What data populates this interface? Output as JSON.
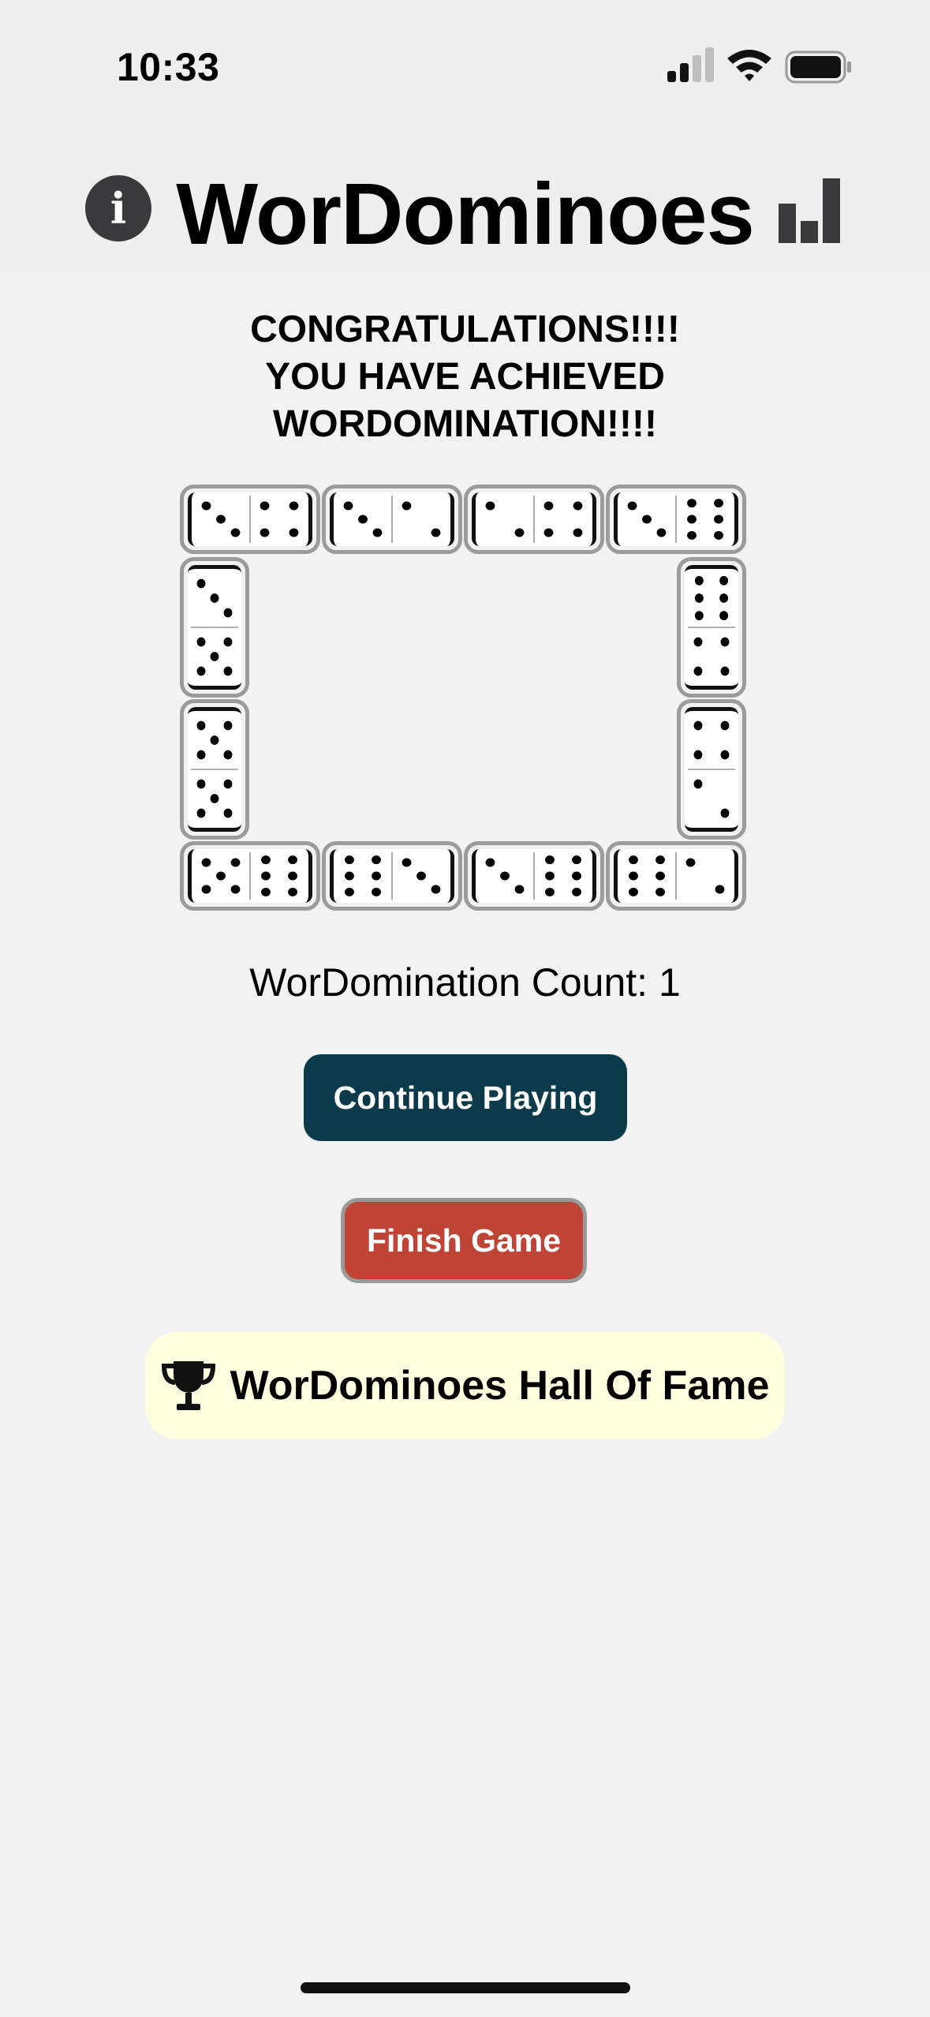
{
  "status_bar": {
    "time": "10:33"
  },
  "header": {
    "title": "WorDominoes",
    "info_icon": "info-icon",
    "stats_icon": "bar-chart-icon"
  },
  "congrats": {
    "line1": "CONGRATULATIONS!!!!",
    "line2": "YOU HAVE ACHIEVED",
    "line3": "WORDOMINATION!!!!"
  },
  "dominoes": [
    {
      "orientation": "horizontal",
      "pips": [
        3,
        4
      ]
    },
    {
      "orientation": "horizontal",
      "pips": [
        3,
        2
      ]
    },
    {
      "orientation": "horizontal",
      "pips": [
        2,
        4
      ]
    },
    {
      "orientation": "horizontal",
      "pips": [
        3,
        6
      ]
    },
    {
      "orientation": "vertical",
      "pips": [
        3,
        5
      ]
    },
    {
      "orientation": "vertical",
      "pips": [
        6,
        4
      ]
    },
    {
      "orientation": "vertical",
      "pips": [
        5,
        5
      ]
    },
    {
      "orientation": "vertical",
      "pips": [
        4,
        2
      ]
    },
    {
      "orientation": "horizontal",
      "pips": [
        5,
        6
      ]
    },
    {
      "orientation": "horizontal",
      "pips": [
        6,
        3
      ]
    },
    {
      "orientation": "horizontal",
      "pips": [
        3,
        6
      ]
    },
    {
      "orientation": "horizontal",
      "pips": [
        6,
        2
      ]
    }
  ],
  "stats": {
    "count_text": "WorDomination Count: 1"
  },
  "buttons": {
    "continue": "Continue Playing",
    "finish": "Finish Game",
    "hall_of_fame": "WorDominoes Hall Of Fame",
    "hall_of_fame_icon": "trophy-icon"
  },
  "colors": {
    "continue_bg": "#0b3b4a",
    "finish_bg": "#c04435",
    "hof_bg": "#fffee0"
  }
}
